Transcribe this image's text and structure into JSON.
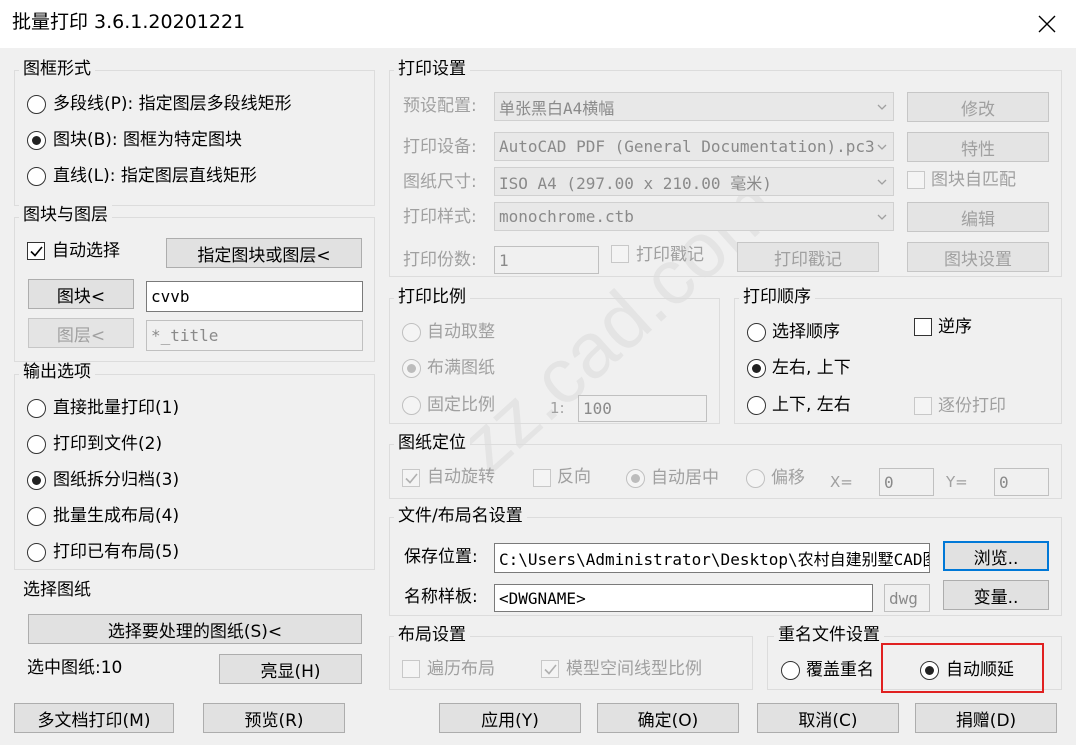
{
  "window": {
    "title": "批量打印 3.6.1.20201221",
    "close_icon": "close-icon"
  },
  "frame_type": {
    "legend": "图框形式",
    "options": [
      {
        "label": "多段线(P): 指定图层多段线矩形",
        "selected": false
      },
      {
        "label": "图块(B): 图框为特定图块",
        "selected": true
      },
      {
        "label": "直线(L): 指定图层直线矩形",
        "selected": false
      }
    ]
  },
  "block_layer": {
    "legend": "图块与图层",
    "auto_select_label": "自动选择",
    "auto_select_checked": true,
    "pick_button": "指定图块或图层<",
    "block_button": "图块<",
    "block_value": "cvvb",
    "layer_button": "图层<",
    "layer_value": "*_title"
  },
  "output": {
    "legend": "输出选项",
    "options": [
      {
        "label": "直接批量打印(1)",
        "selected": false
      },
      {
        "label": "打印到文件(2)",
        "selected": false
      },
      {
        "label": "图纸拆分归档(3)",
        "selected": true
      },
      {
        "label": "批量生成布局(4)",
        "selected": false
      },
      {
        "label": "打印已有布局(5)",
        "selected": false
      }
    ]
  },
  "select_paper": {
    "legend": "选择图纸",
    "select_button": "选择要处理的图纸(S)<",
    "selected_count": "选中图纸:10",
    "highlight_button": "亮显(H)"
  },
  "print_settings": {
    "legend": "打印设置",
    "preset_label": "预设配置:",
    "preset_value": "单张黑白A4横幅",
    "modify_button": "修改",
    "device_label": "打印设备:",
    "device_value": "AutoCAD PDF (General Documentation).pc3",
    "properties_button": "特性",
    "paper_label": "图纸尺寸:",
    "paper_value": "ISO A4 (297.00 x 210.00 毫米)",
    "block_match_label": "图块自匹配",
    "style_label": "打印样式:",
    "style_value": "monochrome.ctb",
    "edit_button": "编辑",
    "copies_label": "打印份数:",
    "copies_value": "1",
    "stamp_label": "打印戳记",
    "stamp_button": "打印戳记",
    "block_settings_button": "图块设置"
  },
  "print_scale": {
    "legend": "打印比例",
    "options": [
      {
        "label": "自动取整",
        "selected": false
      },
      {
        "label": "布满图纸",
        "selected": true
      },
      {
        "label": "固定比例",
        "selected": false
      }
    ],
    "ratio_prefix": "1:",
    "ratio_value": "100"
  },
  "print_order": {
    "legend": "打印顺序",
    "options": [
      {
        "label": "选择顺序",
        "selected": false
      },
      {
        "label": "左右, 上下",
        "selected": true
      },
      {
        "label": "上下, 左右",
        "selected": false
      }
    ],
    "reverse_label": "逆序",
    "collate_label": "逐份打印"
  },
  "paper_position": {
    "legend": "图纸定位",
    "auto_rotate_label": "自动旋转",
    "reverse_label": "反向",
    "auto_center_label": "自动居中",
    "offset_label": "偏移",
    "x_label": "X=",
    "x_value": "0",
    "y_label": "Y=",
    "y_value": "0"
  },
  "file_name": {
    "legend": "文件/布局名设置",
    "save_label": "保存位置:",
    "save_value": "C:\\Users\\Administrator\\Desktop\\农村自建别墅CAD图",
    "browse_button": "浏览..",
    "template_label": "名称样板:",
    "template_value": "<DWGNAME>",
    "ext_value": "dwg",
    "variable_button": "变量.."
  },
  "layout_settings": {
    "legend": "布局设置",
    "traverse_label": "遍历布局",
    "model_linetype_label": "模型空间线型比例"
  },
  "rename": {
    "legend": "重名文件设置",
    "overwrite_label": "覆盖重名",
    "auto_increment_label": "自动顺延"
  },
  "footer": {
    "multi_doc_button": "多文档打印(M)",
    "preview_button": "预览(R)",
    "apply_button": "应用(Y)",
    "ok_button": "确定(O)",
    "cancel_button": "取消(C)",
    "donate_button": "捐赠(D)"
  },
  "colors": {
    "accent": "#0078d7",
    "highlight_box": "#e02020"
  }
}
